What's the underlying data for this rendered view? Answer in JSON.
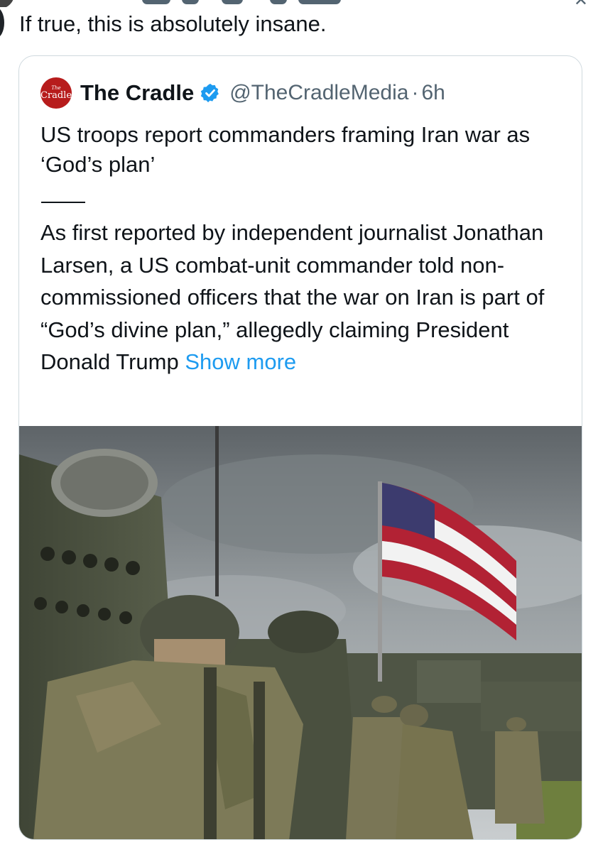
{
  "tweet": {
    "text": "If true, this is absolutely insane."
  },
  "quote": {
    "avatar_text_top": "The",
    "avatar_text_bottom": "Cradle",
    "author_name": "The Cradle",
    "verified": true,
    "handle": "@TheCradleMedia",
    "separator": "·",
    "time": "6h",
    "headline": "US troops report commanders framing Iran war as ‘God’s plan’",
    "body": "As first reported by independent journalist Jonathan Larsen, a US combat-unit commander told non-commissioned officers that the war on Iran is part of “God’s divine plan,” allegedly claiming President Donald Trump",
    "show_more": "Show more"
  },
  "colors": {
    "text": "#0f1419",
    "secondary": "#536471",
    "link": "#1d9bf0",
    "border": "#cfd9de",
    "avatar_red": "#b71c1c",
    "verified_blue": "#1d9bf0"
  },
  "icons": {
    "verified": "verified-badge-icon",
    "close": "close-icon"
  }
}
